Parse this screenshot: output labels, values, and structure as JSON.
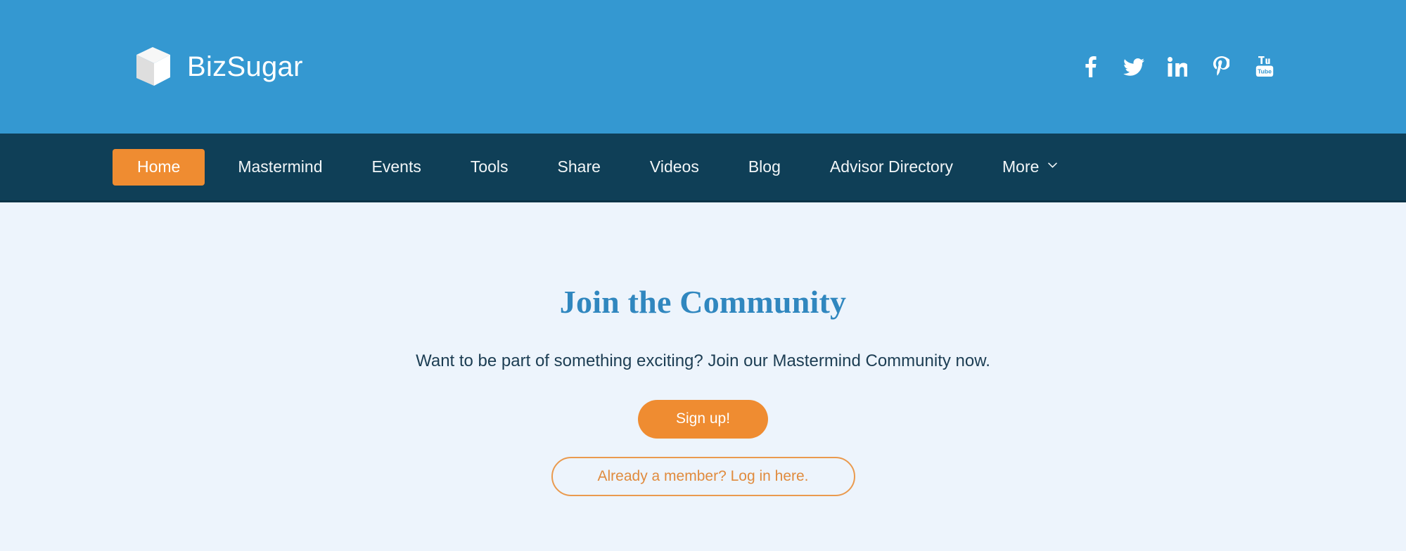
{
  "header": {
    "brand_name": "BizSugar",
    "logo_icon": "sugar-cube-icon",
    "background_color": "#3498d1",
    "social": [
      {
        "name": "facebook",
        "icon": "facebook-icon",
        "label": "Facebook"
      },
      {
        "name": "twitter",
        "icon": "twitter-icon",
        "label": "Twitter"
      },
      {
        "name": "linkedin",
        "icon": "linkedin-icon",
        "label": "LinkedIn"
      },
      {
        "name": "pinterest",
        "icon": "pinterest-icon",
        "label": "Pinterest"
      },
      {
        "name": "youtube",
        "icon": "youtube-icon",
        "label": "YouTube"
      }
    ]
  },
  "nav": {
    "background_color": "#0f3f57",
    "active_color": "#ef8c31",
    "items": [
      {
        "label": "Home",
        "active": true
      },
      {
        "label": "Mastermind",
        "active": false
      },
      {
        "label": "Events",
        "active": false
      },
      {
        "label": "Tools",
        "active": false
      },
      {
        "label": "Share",
        "active": false
      },
      {
        "label": "Videos",
        "active": false
      },
      {
        "label": "Blog",
        "active": false
      },
      {
        "label": "Advisor Directory",
        "active": false
      },
      {
        "label": "More",
        "active": false,
        "icon": "chevron-down-icon"
      }
    ]
  },
  "hero": {
    "background_color": "#edf4fc",
    "title": "Join the Community",
    "title_color": "#3087bf",
    "subtitle": "Want to be part of something exciting? Join our Mastermind Community now.",
    "signup_label": "Sign up!",
    "login_label": "Already a member? Log in here.",
    "accent_color": "#ef8c31"
  }
}
